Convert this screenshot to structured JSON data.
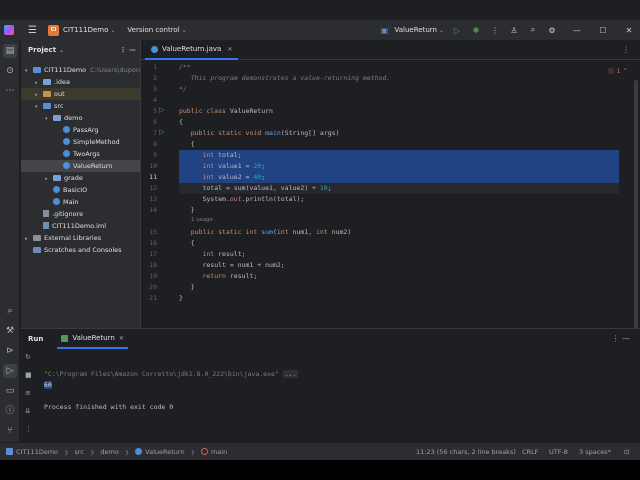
{
  "titlebar": {
    "project_badge": "CI",
    "project_name": "CIT111Demo",
    "vcs": "Version control",
    "run_config": "ValueReturn"
  },
  "project_pane": {
    "title": "Project",
    "items": [
      {
        "label": "CIT111Demo",
        "extra": "C:\\Users\\dupon",
        "indent": 0,
        "arrow": "▾",
        "icon": "module"
      },
      {
        "label": ".idea",
        "indent": 1,
        "arrow": "▸",
        "icon": "folder"
      },
      {
        "label": "out",
        "indent": 1,
        "arrow": "▸",
        "icon": "folder-orange"
      },
      {
        "label": "src",
        "indent": 1,
        "arrow": "▾",
        "icon": "folder-blue"
      },
      {
        "label": "demo",
        "indent": 2,
        "arrow": "▾",
        "icon": "folder"
      },
      {
        "label": "PassArg",
        "indent": 3,
        "arrow": "",
        "icon": "class"
      },
      {
        "label": "SimpleMethod",
        "indent": 3,
        "arrow": "",
        "icon": "class"
      },
      {
        "label": "TwoArgs",
        "indent": 3,
        "arrow": "",
        "icon": "class"
      },
      {
        "label": "ValueReturn",
        "indent": 3,
        "arrow": "",
        "icon": "class"
      },
      {
        "label": "grade",
        "indent": 2,
        "arrow": "▸",
        "icon": "folder"
      },
      {
        "label": "BasicIO",
        "indent": 2,
        "arrow": "",
        "icon": "class"
      },
      {
        "label": "Main",
        "indent": 2,
        "arrow": "",
        "icon": "class"
      },
      {
        "label": ".gitignore",
        "indent": 1,
        "arrow": "",
        "icon": "file"
      },
      {
        "label": "CIT111Demo.iml",
        "indent": 1,
        "arrow": "",
        "icon": "iml"
      },
      {
        "label": "External Libraries",
        "indent": 0,
        "arrow": "▸",
        "icon": "lib"
      },
      {
        "label": "Scratches and Consoles",
        "indent": 0,
        "arrow": "",
        "icon": "scratch"
      }
    ]
  },
  "editor": {
    "tab_label": "ValueReturn.java",
    "error_count": "1",
    "usage_hint": "1 usage",
    "lines": [
      {
        "n": "1",
        "html": "<span class=\"cm\">/**</span>"
      },
      {
        "n": "2",
        "html": "<span class=\"cm\">   This program demonstrates a value-returning method.</span>"
      },
      {
        "n": "3",
        "html": "<span class=\"cm\">*/</span>"
      },
      {
        "n": "4",
        "html": ""
      },
      {
        "n": "5",
        "html": "<span class=\"kw\">public class</span> ValueReturn"
      },
      {
        "n": "6",
        "html": "{"
      },
      {
        "n": "7",
        "html": "   <span class=\"kw\">public static void</span> <span class=\"fn\">main</span>(String[] args)"
      },
      {
        "n": "8",
        "html": "   {"
      },
      {
        "n": "9",
        "html": "      <span class=\"kw\">int</span> total;"
      },
      {
        "n": "10",
        "html": "      <span class=\"kw\">int</span> value1 = <span class=\"num\">20</span>;"
      },
      {
        "n": "11",
        "html": "      <span class=\"kw\">int</span> value2 = <span class=\"num\">40</span>;"
      },
      {
        "n": "12",
        "html": "      total = sum(value1, value2) + <span class=\"num\">10</span>;"
      },
      {
        "n": "13",
        "html": "      System.<span class=\"st\">out</span>.println(total);"
      },
      {
        "n": "14",
        "html": "   }"
      },
      {
        "n": "15",
        "html": "   <span class=\"kw\">public static int</span> <span class=\"fn\">sum</span>(<span class=\"kw\">int</span> num1, <span class=\"kw\">int</span> num2)"
      },
      {
        "n": "16",
        "html": "   {"
      },
      {
        "n": "17",
        "html": "      <span class=\"kw\">int</span> result;"
      },
      {
        "n": "18",
        "html": "      result = num1 + num2;"
      },
      {
        "n": "19",
        "html": "      <span class=\"kw\">return</span> result;"
      },
      {
        "n": "20",
        "html": "   }"
      },
      {
        "n": "21",
        "html": "}"
      }
    ]
  },
  "run_pane": {
    "title": "Run",
    "tab_label": "ValueReturn",
    "command": "\"C:\\Program Files\\Amazon Corretto\\jdk1.8.0_222\\bin\\java.exe\"",
    "collapsed": "...",
    "output": "60",
    "finish": "Process finished with exit code 0"
  },
  "statusbar": {
    "crumbs": [
      "CIT111Demo",
      "src",
      "demo",
      "ValueReturn",
      "main"
    ],
    "position": "11:23 (56 chars, 2 line breaks)",
    "line_sep": "CRLF",
    "encoding": "UTF-8",
    "indent": "3 spaces*"
  }
}
